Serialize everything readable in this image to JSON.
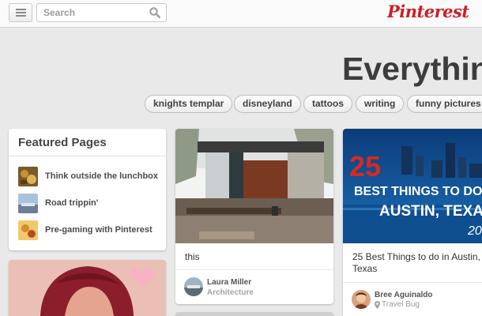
{
  "header": {
    "menu_icon": "hamburger-menu-icon",
    "search": {
      "placeholder": "Search",
      "icon": "search-icon"
    },
    "logo": "Pinterest",
    "brand_color": "#cb2027"
  },
  "headline": "Everythin",
  "categories": [
    "knights templar",
    "disneyland",
    "tattoos",
    "writing",
    "funny pictures"
  ],
  "featured": {
    "title": "Featured Pages",
    "items": [
      {
        "label": "Think outside the lunchbox"
      },
      {
        "label": "Road trippin'"
      },
      {
        "label": "Pre-gaming with Pinterest"
      }
    ]
  },
  "pins": [
    {
      "description": "this",
      "user": "Laura Miller",
      "board": "Architecture"
    },
    {
      "description": "25 Best Things to do in Austin, Texas",
      "user": "Bree Aguinaldo",
      "board": "Travel Bug",
      "board_icon": "location-pin-icon",
      "image_text": {
        "number": "25",
        "line1": "BEST THINGS TO DO IN",
        "line2": "AUSTIN, TEXAS",
        "year": "20"
      }
    }
  ],
  "photo_card": {
    "heart_icon": "heart-icon"
  }
}
